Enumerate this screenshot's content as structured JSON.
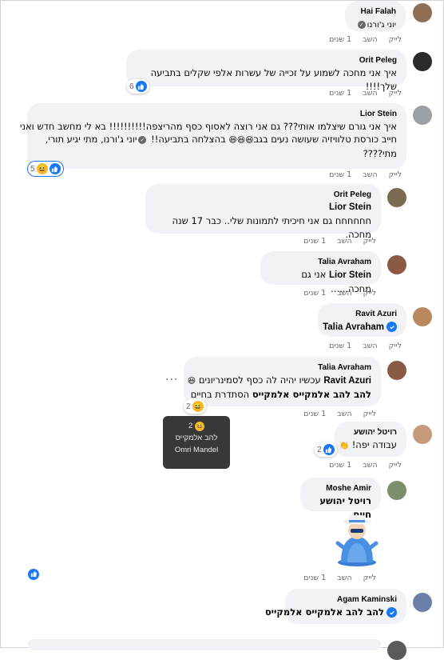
{
  "actions": {
    "like": "לייק",
    "reply": "השב",
    "time": "1 שנים"
  },
  "comments": [
    {
      "author": "Hai Falah",
      "line1_mention": "יוני ג'ורנו"
    },
    {
      "author": "Orit Peleg",
      "text": "איך אני מחכה לשמוע על זכייה של עשרות אלפי שקלים בתביעה שלך!!!!",
      "reactions": "6"
    },
    {
      "author": "Lior Stein",
      "line1": "איך אני גורם שיצלמו אותי??? גם אני רוצה לאסוף כסף מהריצפה!!!!!!!!!! בא לי מחשב חדש ואני",
      "line2_a": "חייב כורסת טלוויזיה שעושה נעים בגב",
      "line2_b": "בהצלחה בתביעה!!",
      "line2_mention": "יוני ג'ורנו, מתי יגיע תורי,",
      "line3": "מתי????",
      "reactions": "5"
    },
    {
      "author": "Orit Peleg",
      "mention": "Lior Stein",
      "text": "חחחחחח גם אני חיכיתי לתמונות שלי.. כבר 17 שנה מחכה."
    },
    {
      "author": "Talia Avraham",
      "mention": "Lior Stein",
      "text": "אני גם מחכה......"
    },
    {
      "author": "Ravit Azuri",
      "mention": "Talia Avraham"
    },
    {
      "author": "Talia Avraham",
      "mention": "Ravit Azuri",
      "line1": "עכשיו יהיה לה כסף לסמינריונים",
      "line2_bold": "להב להב אלמקייס אלמקייס",
      "line2_rest": "הסתדרת בחיים",
      "reactions": "2"
    },
    {
      "author": "רויטל יהושע",
      "text": "עבודה יפה!",
      "reactions": "2"
    },
    {
      "author": "Moshe Amir",
      "text": "רויטל יהושע חיים"
    },
    {
      "author": "Agam Kaminski",
      "text": "להב להב אלמקייס אלמקייס"
    }
  ],
  "tooltip": {
    "count": "2",
    "line1": "להב אלמקייס",
    "line2": "Omri Mandel"
  },
  "colors": {
    "like_blue": "#1877f2",
    "bubble": "#f0f2f5",
    "meta": "#65676b"
  }
}
